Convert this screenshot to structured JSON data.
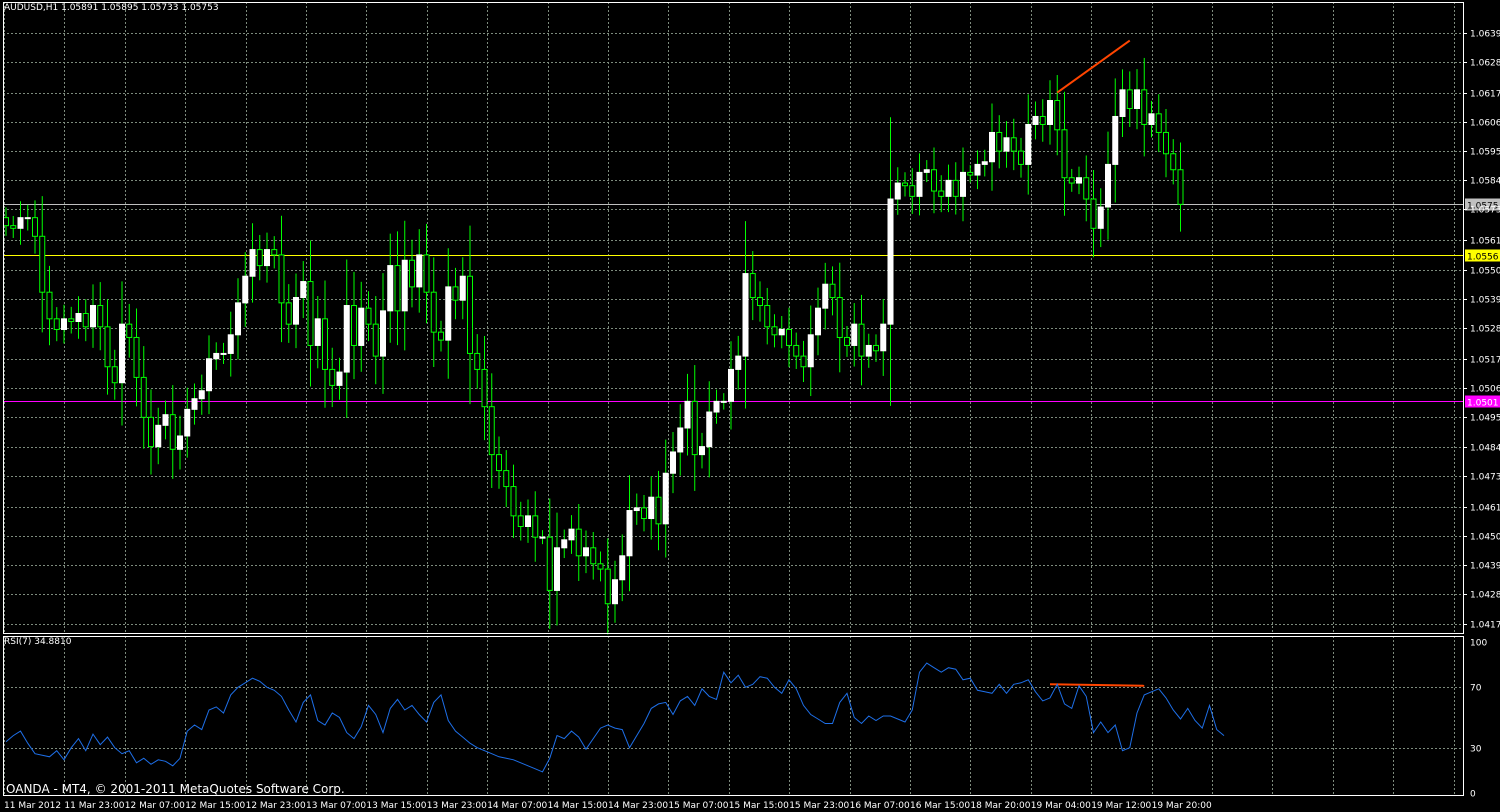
{
  "header": {
    "symbol_info": "AUDUSD,H1  1.05891 1.05895 1.05733 1.05753"
  },
  "rsi": {
    "label": "RSI(7) 34.8810",
    "levels": [
      "100",
      "70",
      "30",
      "0"
    ]
  },
  "footer": {
    "copyright": "OANDA - MT4, © 2001-2011 MetaQuotes Software Corp."
  },
  "colors": {
    "background": "#000000",
    "grid": "#7d8b7d",
    "frame": "#ffffff",
    "bull_candle": "#ffffff",
    "bear_candle": "#00ff00",
    "bid_line": "#c0c0c0",
    "support_line": "#ffff00",
    "level_line": "#ff00ff",
    "trendline": "#ff4500",
    "rsi_line": "#1e6fe8"
  },
  "chart_data": {
    "type": "candlestick",
    "price_ticks": [
      "1.06395",
      "1.06285",
      "1.06170",
      "1.06060",
      "1.05950",
      "1.05840",
      "1.05733",
      "1.05615",
      "1.05505",
      "1.05395",
      "1.05285",
      "1.05170",
      "1.05060",
      "1.04950",
      "1.04840",
      "1.04730",
      "1.04615",
      "1.04505",
      "1.04395",
      "1.04285",
      "1.04175"
    ],
    "time_labels": [
      "11 Mar 2012",
      "11 Mar 23:00",
      "12 Mar 07:00",
      "12 Mar 15:00",
      "12 Mar 23:00",
      "13 Mar 07:00",
      "13 Mar 15:00",
      "13 Mar 23:00",
      "14 Mar 07:00",
      "14 Mar 15:00",
      "14 Mar 23:00",
      "15 Mar 07:00",
      "15 Mar 15:00",
      "15 Mar 23:00",
      "16 Mar 07:00",
      "16 Mar 15:00",
      "18 Mar 20:00",
      "19 Mar 04:00",
      "19 Mar 12:00",
      "19 Mar 20:00"
    ],
    "ylim": [
      1.0414,
      1.0651
    ],
    "price_markers": [
      {
        "name": "bid",
        "value": 1.05753,
        "label": "1.0575"
      },
      {
        "name": "support",
        "value": 1.0556,
        "label": "1.0556"
      },
      {
        "name": "level",
        "value": 1.0501,
        "label": "1.0501"
      }
    ],
    "trendlines": [
      {
        "pane": "price",
        "from_index": 145,
        "to_index": 155,
        "from_value": 1.0617,
        "to_value": 1.06365
      },
      {
        "pane": "rsi",
        "from_index": 144,
        "to_index": 157,
        "from_value": 72,
        "to_value": 71
      }
    ],
    "closes": [
      1.0567,
      1.0566,
      1.057,
      1.057,
      1.0563,
      1.0542,
      1.0532,
      1.0528,
      1.0532,
      1.0531,
      1.0534,
      1.0529,
      1.0537,
      1.0529,
      1.0514,
      1.0508,
      1.053,
      1.0525,
      1.051,
      1.0495,
      1.0484,
      1.0492,
      1.0496,
      1.0483,
      1.0488,
      1.0498,
      1.0502,
      1.0505,
      1.0517,
      1.0519,
      1.0519,
      1.0526,
      1.0538,
      1.0548,
      1.0558,
      1.0552,
      1.0558,
      1.0556,
      1.0538,
      1.053,
      1.054,
      1.0546,
      1.0522,
      1.0532,
      1.0513,
      1.0507,
      1.0512,
      1.0537,
      1.0522,
      1.0536,
      1.053,
      1.0518,
      1.0535,
      1.0552,
      1.0535,
      1.0554,
      1.0544,
      1.0556,
      1.0542,
      1.0527,
      1.0524,
      1.0544,
      1.0539,
      1.0548,
      1.0519,
      1.0513,
      1.0499,
      1.0481,
      1.0475,
      1.0469,
      1.0458,
      1.0454,
      1.0458,
      1.045,
      1.045,
      1.043,
      1.0446,
      1.0449,
      1.0453,
      1.0443,
      1.0446,
      1.044,
      1.0438,
      1.0425,
      1.0434,
      1.0443,
      1.046,
      1.0461,
      1.0457,
      1.0465,
      1.0455,
      1.0474,
      1.0482,
      1.0491,
      1.0501,
      1.0481,
      1.0484,
      1.0497,
      1.0501,
      1.0501,
      1.0513,
      1.0518,
      1.0549,
      1.054,
      1.0537,
      1.0529,
      1.0526,
      1.0528,
      1.0522,
      1.0518,
      1.0514,
      1.0526,
      1.0536,
      1.0545,
      1.054,
      1.0525,
      1.0522,
      1.053,
      1.0518,
      1.0522,
      1.052,
      1.053,
      1.0577,
      1.0583,
      1.0582,
      1.0578,
      1.0587,
      1.0588,
      1.058,
      1.0578,
      1.0584,
      1.0578,
      1.0587,
      1.0586,
      1.059,
      1.0591,
      1.0602,
      1.0595,
      1.06,
      1.0595,
      1.059,
      1.0605,
      1.0608,
      1.0605,
      1.0614,
      1.0603,
      1.0585,
      1.0583,
      1.0585,
      1.0577,
      1.0566,
      1.0574,
      1.059,
      1.0608,
      1.0618,
      1.0611,
      1.0618,
      1.0605,
      1.0609,
      1.0602,
      1.0594,
      1.0588,
      1.0575
    ],
    "rsi": [
      34,
      38,
      41,
      33,
      26,
      25,
      24,
      28,
      22,
      30,
      36,
      28,
      39,
      32,
      37,
      30,
      26,
      28,
      20,
      23,
      19,
      22,
      21,
      18,
      23,
      41,
      45,
      42,
      55,
      57,
      53,
      65,
      70,
      73,
      76,
      74,
      70,
      68,
      64,
      55,
      47,
      60,
      65,
      48,
      45,
      53,
      50,
      40,
      36,
      44,
      58,
      52,
      40,
      56,
      62,
      55,
      58,
      52,
      47,
      60,
      65,
      48,
      41,
      37,
      33,
      30,
      28,
      26,
      24,
      23,
      22,
      20,
      18,
      16,
      14,
      23,
      38,
      36,
      41,
      37,
      29,
      36,
      43,
      45,
      43,
      42,
      30,
      38,
      46,
      56,
      59,
      60,
      52,
      61,
      64,
      58,
      69,
      64,
      62,
      80,
      73,
      78,
      70,
      72,
      77,
      76,
      70,
      66,
      75,
      69,
      58,
      52,
      49,
      46,
      46,
      60,
      66,
      50,
      46,
      51,
      48,
      51,
      51,
      49,
      47,
      55,
      80,
      86,
      83,
      80,
      83,
      82,
      75,
      76,
      68,
      67,
      66,
      72,
      66,
      72,
      73,
      75,
      67,
      61,
      63,
      72,
      59,
      56,
      71,
      64,
      40,
      47,
      40,
      45,
      28,
      30,
      53,
      65,
      67,
      69,
      63,
      55,
      49,
      56,
      48,
      43,
      58,
      42,
      38
    ]
  }
}
